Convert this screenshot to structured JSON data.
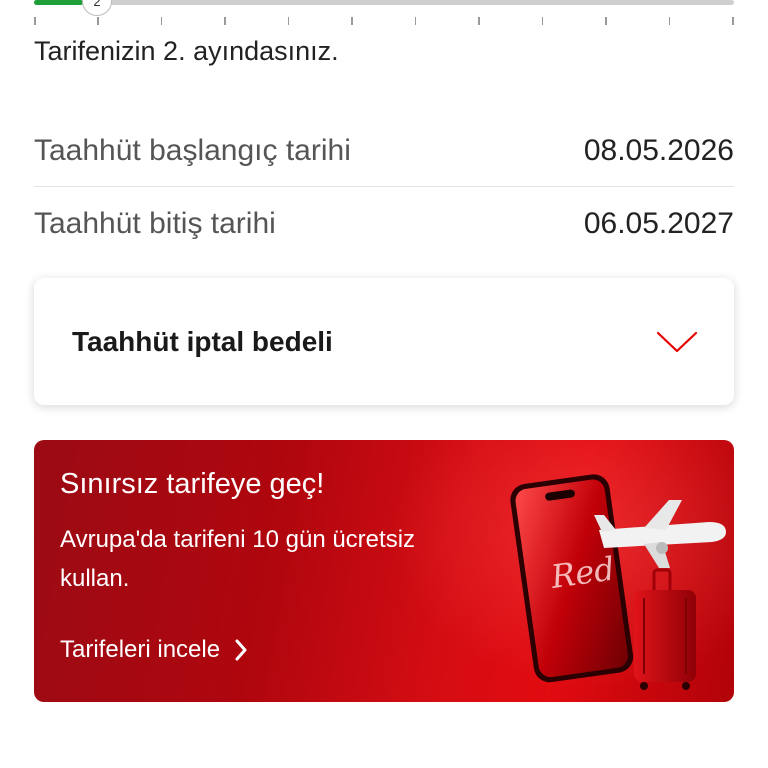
{
  "progress": {
    "current_month": "2",
    "fraction": 0.07
  },
  "tariff_status": "Tarifenizin 2. ayındasınız.",
  "commitment": {
    "start_label": "Taahhüt başlangıç tarihi",
    "start_value": "08.05.2026",
    "end_label": "Taahhüt bitiş tarihi",
    "end_value": "06.05.2027"
  },
  "cancellation": {
    "title": "Taahhüt iptal bedeli",
    "icon": "chevron-down-icon",
    "accent": "#e60000"
  },
  "promo": {
    "title": "Sınırsız tarifeye geç!",
    "description": "Avrupa'da tarifeni 10 gün ücretsiz kullan.",
    "cta_label": "Tarifeleri incele",
    "cta_icon": "chevron-right-icon",
    "art_text": "Red",
    "bg_color": "#c8080f"
  }
}
